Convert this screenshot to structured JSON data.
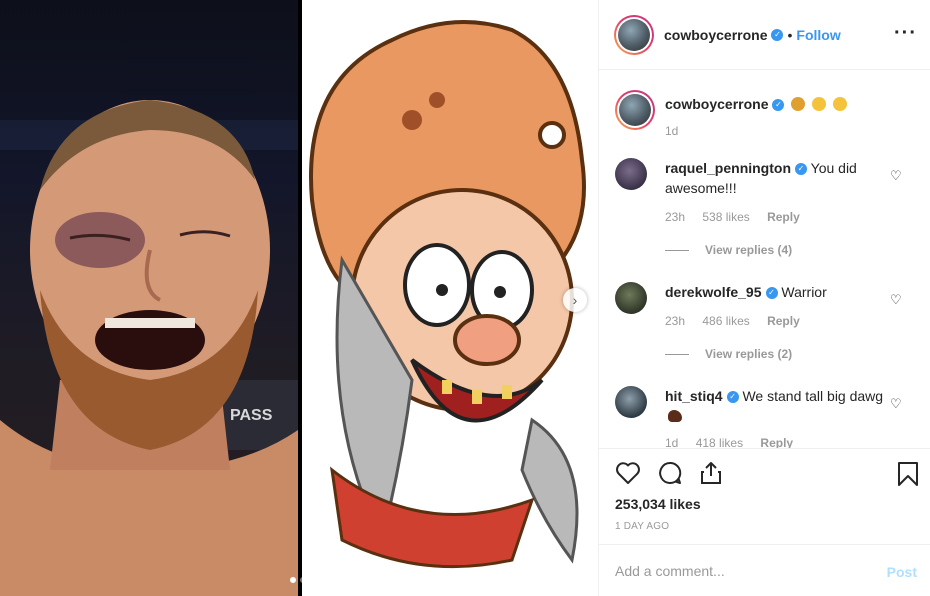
{
  "post": {
    "author": "cowboycerrone",
    "follow_label": "Follow",
    "separator": "•",
    "more_icon": "more-horizontal-icon"
  },
  "caption": {
    "username": "cowboycerrone",
    "emojis": [
      "cowboy-face",
      "confounded-face",
      "tongue-out-face"
    ],
    "time": "1d"
  },
  "comments": [
    {
      "username": "raquel_pennington",
      "text": "You did awesome!!!",
      "time": "23h",
      "likes": "538 likes",
      "reply_label": "Reply",
      "view_replies": "View replies (4)"
    },
    {
      "username": "derekwolfe_95",
      "text": "Warrior",
      "time": "23h",
      "likes": "486 likes",
      "reply_label": "Reply",
      "view_replies": "View replies (2)"
    },
    {
      "username": "hit_stiq4",
      "text": "We stand tall big dawg",
      "time": "1d",
      "likes": "418 likes",
      "reply_label": "Reply"
    }
  ],
  "actions": {
    "icons": [
      "heart-icon",
      "comment-icon",
      "share-icon",
      "bookmark-icon"
    ],
    "likes": "253,034 likes",
    "posted_ago": "1 DAY AGO"
  },
  "comment_box": {
    "placeholder": "Add a comment...",
    "post_label": "Post"
  },
  "colors": {
    "link_blue": "#3897f0",
    "post_disabled": "#b2dffc",
    "muted": "#999999"
  },
  "carousel": {
    "total": 2,
    "current": 1
  }
}
